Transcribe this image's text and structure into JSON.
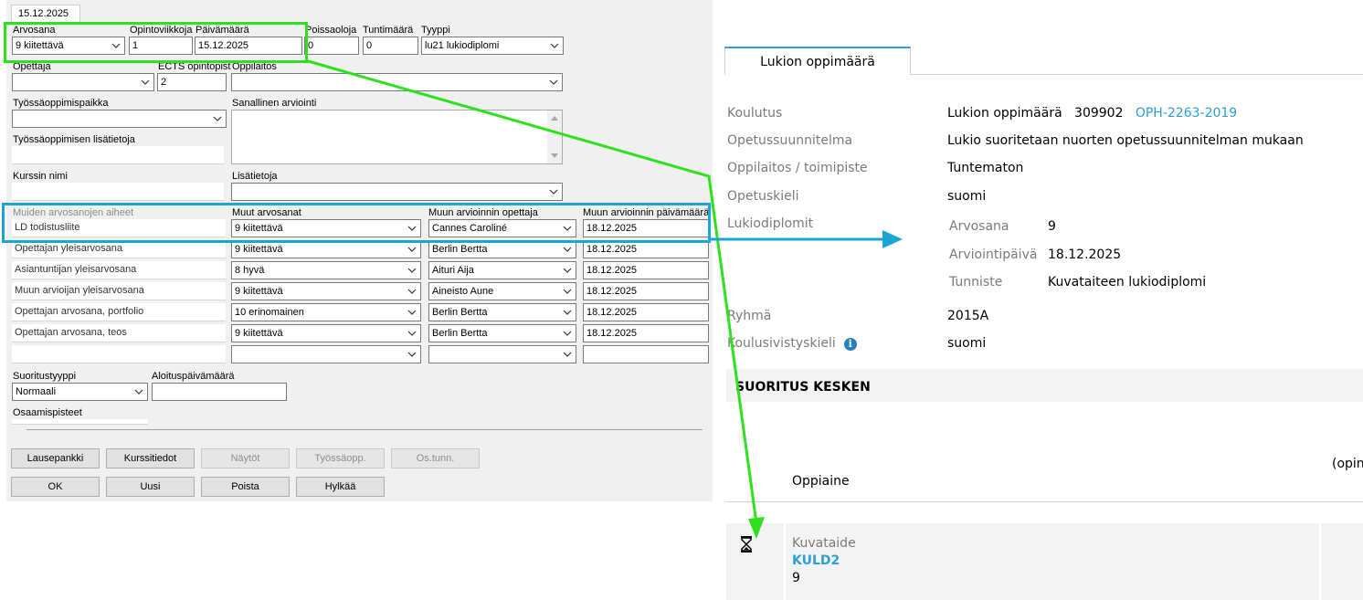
{
  "form": {
    "date_tab": "15.12.2025",
    "row1": {
      "arvosana_label": "Arvosana",
      "arvosana_value": "9 kiitettävä",
      "opintoviikkoja_label": "Opintoviikkoja",
      "opintoviikkoja_value": "1",
      "paivamaara_label": "Päivämäärä",
      "paivamaara_value": "15.12.2025",
      "poissaoloja_label": "Poissaoloja",
      "poissaoloja_value": "0",
      "tuntimaara_label": "Tuntimäärä",
      "tuntimaara_value": "0",
      "tyyppi_label": "Tyyppi",
      "tyyppi_value": "lu21 lukiodiplomi"
    },
    "row2": {
      "opettaja_label": "Opettaja",
      "opettaja_value": "",
      "ects_label": "ECTS opintopist",
      "ects_value": "2",
      "oppilaitos_label": "Oppilaitos",
      "oppilaitos_value": ""
    },
    "tyossaoppimispaikka_label": "Työssäoppimispaikka",
    "sanallinen_label": "Sanallinen arviointi",
    "tyossaoppimisen_lisatietoja_label": "Työssäoppimisen lisätietoja",
    "kurssin_nimi_label": "Kurssin nimi",
    "lisatietoja_label": "Lisätietoja",
    "grid": {
      "headers": [
        "Muiden arvosanojen aiheet",
        "Muut arvosanat",
        "Muun arvioinnin opettaja",
        "Muun arvioinnin päivämäärä"
      ],
      "rows": [
        {
          "aihe": "LD todistusliite",
          "arvosana": "9 kiitettävä",
          "opettaja": "Cannes Caroliné",
          "pvm": "18.12.2025"
        },
        {
          "aihe": "Opettajan yleisarvosana",
          "arvosana": "9 kiitettävä",
          "opettaja": "Berlin Bertta",
          "pvm": "18.12.2025"
        },
        {
          "aihe": "Asiantuntijan yleisarvosana",
          "arvosana": "8 hyvä",
          "opettaja": "Aituri Aija",
          "pvm": "18.12.2025"
        },
        {
          "aihe": "Muun arvioijan yleisarvosana",
          "arvosana": "9 kiitettävä",
          "opettaja": "Aineisto Aune",
          "pvm": "18.12.2025"
        },
        {
          "aihe": "Opettajan arvosana, portfolio",
          "arvosana": "10 erinomainen",
          "opettaja": "Berlin Bertta",
          "pvm": "18.12.2025"
        },
        {
          "aihe": "Opettajan arvosana, teos",
          "arvosana": "9 kiitettävä",
          "opettaja": "Berlin Bertta",
          "pvm": "18.12.2025"
        },
        {
          "aihe": "",
          "arvosana": "",
          "opettaja": "",
          "pvm": ""
        }
      ]
    },
    "suoritustyyppi_label": "Suoritustyyppi",
    "suoritustyyppi_value": "Normaali",
    "aloituspaivamaara_label": "Aloituspäivämäärä",
    "aloituspaivamaara_value": "",
    "osaamispisteet_label": "Osaamispisteet",
    "buttons_row1": [
      "Lausepankki",
      "Kurssitiedot",
      "Näytöt",
      "Työssäopp.",
      "Os.tunn."
    ],
    "buttons_row2": [
      "OK",
      "Uusi",
      "Poista",
      "Hylkää"
    ]
  },
  "web": {
    "tab_label": "Lukion oppimäärä",
    "koulutus_label": "Koulutus",
    "koulutus_name": "Lukion oppimäärä",
    "koulutus_code": "309902",
    "koulutus_link": "OPH-2263-2019",
    "ops_label": "Opetussuunnitelma",
    "ops_value": "Lukio suoritetaan nuorten opetussuunnitelman mukaan",
    "oppilaitos_label": "Oppilaitos / toimipiste",
    "oppilaitos_value": "Tuntematon",
    "opetuskieli_label": "Opetuskieli",
    "opetuskieli_value": "suomi",
    "lukiodiplomit_label": "Lukiodiplomit",
    "diplomi": {
      "arvosana_label": "Arvosana",
      "arvosana_value": "9",
      "arviointipaiva_label": "Arviointipäivä",
      "arviointipaiva_value": "18.12.2025",
      "tunniste_label": "Tunniste",
      "tunniste_value": "Kuvataiteen lukiodiplomi"
    },
    "ryhma_label": "Ryhmä",
    "ryhma_value": "2015A",
    "koulusivistyskieli_label": "Koulusivistyskieli",
    "koulusivistyskieli_value": "suomi",
    "status": "SUORITUS KESKEN",
    "oppiaine_header": "Oppiaine",
    "cut_header": "(opin",
    "course": {
      "subject": "Kuvataide",
      "code": "KULD2",
      "grade": "9"
    }
  },
  "colors": {
    "green_highlight": "#2fe01e",
    "blue_highlight": "#1aa6d4",
    "link": "#2a9fd8"
  }
}
